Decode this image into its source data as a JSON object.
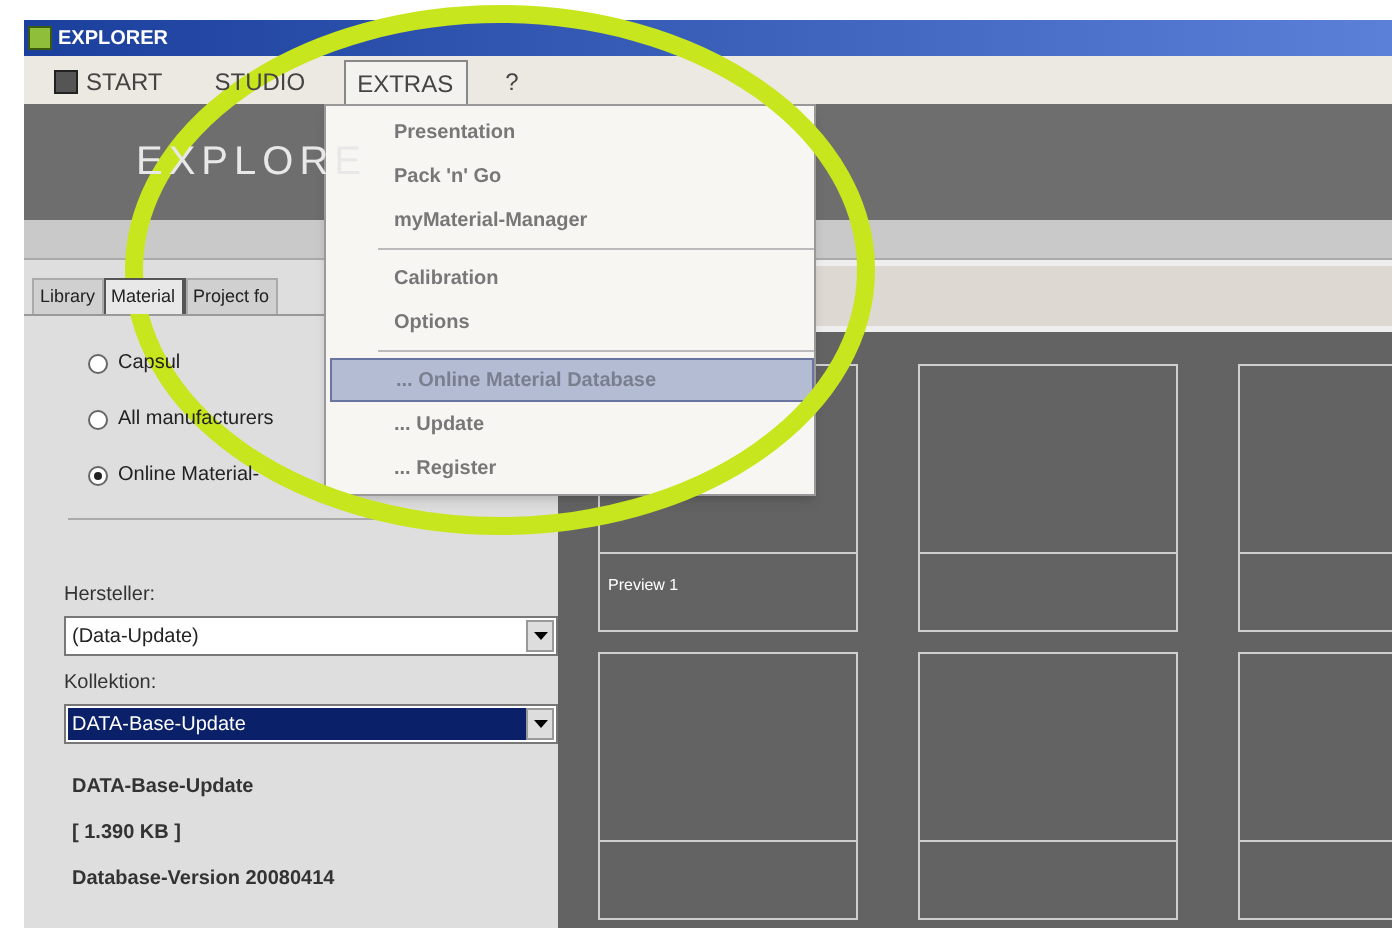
{
  "window": {
    "title": "EXPLORER"
  },
  "menu_bar": [
    {
      "label": "START",
      "selected": false
    },
    {
      "label": "STUDIO",
      "selected": false
    },
    {
      "label": "EXTRAS",
      "selected": true
    },
    {
      "label": "?",
      "selected": false
    }
  ],
  "banner": {
    "title": "EXPLORE"
  },
  "extras_menu": [
    {
      "kind": "item",
      "label": "Presentation",
      "selected": false
    },
    {
      "kind": "item",
      "label": "Pack 'n' Go",
      "selected": false
    },
    {
      "kind": "item",
      "label": "myMaterial-Manager",
      "selected": false
    },
    {
      "kind": "separator"
    },
    {
      "kind": "item",
      "label": "Calibration",
      "selected": false
    },
    {
      "kind": "item",
      "label": "Options",
      "selected": false
    },
    {
      "kind": "separator"
    },
    {
      "kind": "item",
      "label": "... Online Material Database",
      "selected": true
    },
    {
      "kind": "item",
      "label": "... Update",
      "selected": false
    },
    {
      "kind": "item",
      "label": "... Register",
      "selected": false
    }
  ],
  "tabs": [
    {
      "label": "Library",
      "selected": false
    },
    {
      "label": "Material",
      "selected": true
    },
    {
      "label": "Project fo",
      "selected": false
    }
  ],
  "source_options": [
    {
      "label": "Capsul",
      "selected": false
    },
    {
      "label": "All manufacturers",
      "selected": false
    },
    {
      "label": "Online Material-",
      "selected": true
    }
  ],
  "manufacturer": {
    "label": "Hersteller:",
    "value": "(Data-Update)",
    "highlighted": false
  },
  "collection": {
    "label": "Kollektion:",
    "value": "DATA-Base-Update",
    "highlighted": true
  },
  "info": {
    "title": "DATA-Base-Update",
    "size": "[ 1.390 KB ]",
    "version": "Database-Version 20080414"
  },
  "preview_captions": [
    "Preview 1"
  ]
}
